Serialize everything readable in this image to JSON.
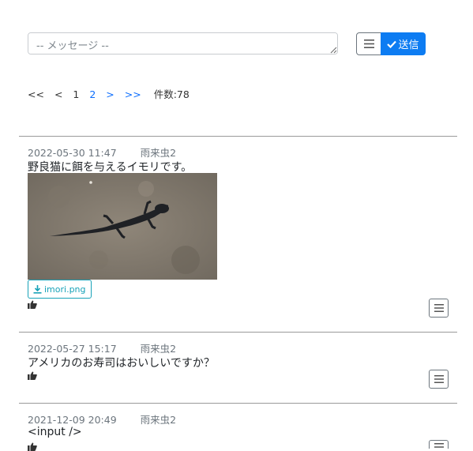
{
  "composer": {
    "placeholder": "-- メッセージ --",
    "send_label": "送信",
    "menu_icon": "bars-icon",
    "send_icon": "check-icon",
    "accent_color": "#0d7cf2"
  },
  "pager": {
    "first": "<<",
    "prev": "<",
    "pages": [
      "1",
      "2"
    ],
    "current_page": "1",
    "next": ">",
    "last": ">>",
    "count_label": "件数:78"
  },
  "posts": [
    {
      "date": "2022-05-30 11:47",
      "author": "雨来虫2",
      "text": "野良猫に餌を与えるイモリです。",
      "attachment": "imori.png",
      "image": "newt-on-concrete-photo"
    },
    {
      "date": "2022-05-27 15:17",
      "author": "雨来虫2",
      "text": "アメリカのお寿司はおいしいですか？"
    },
    {
      "date": "2021-12-09 20:49",
      "author": "雨来虫2",
      "text": "<input />"
    }
  ]
}
